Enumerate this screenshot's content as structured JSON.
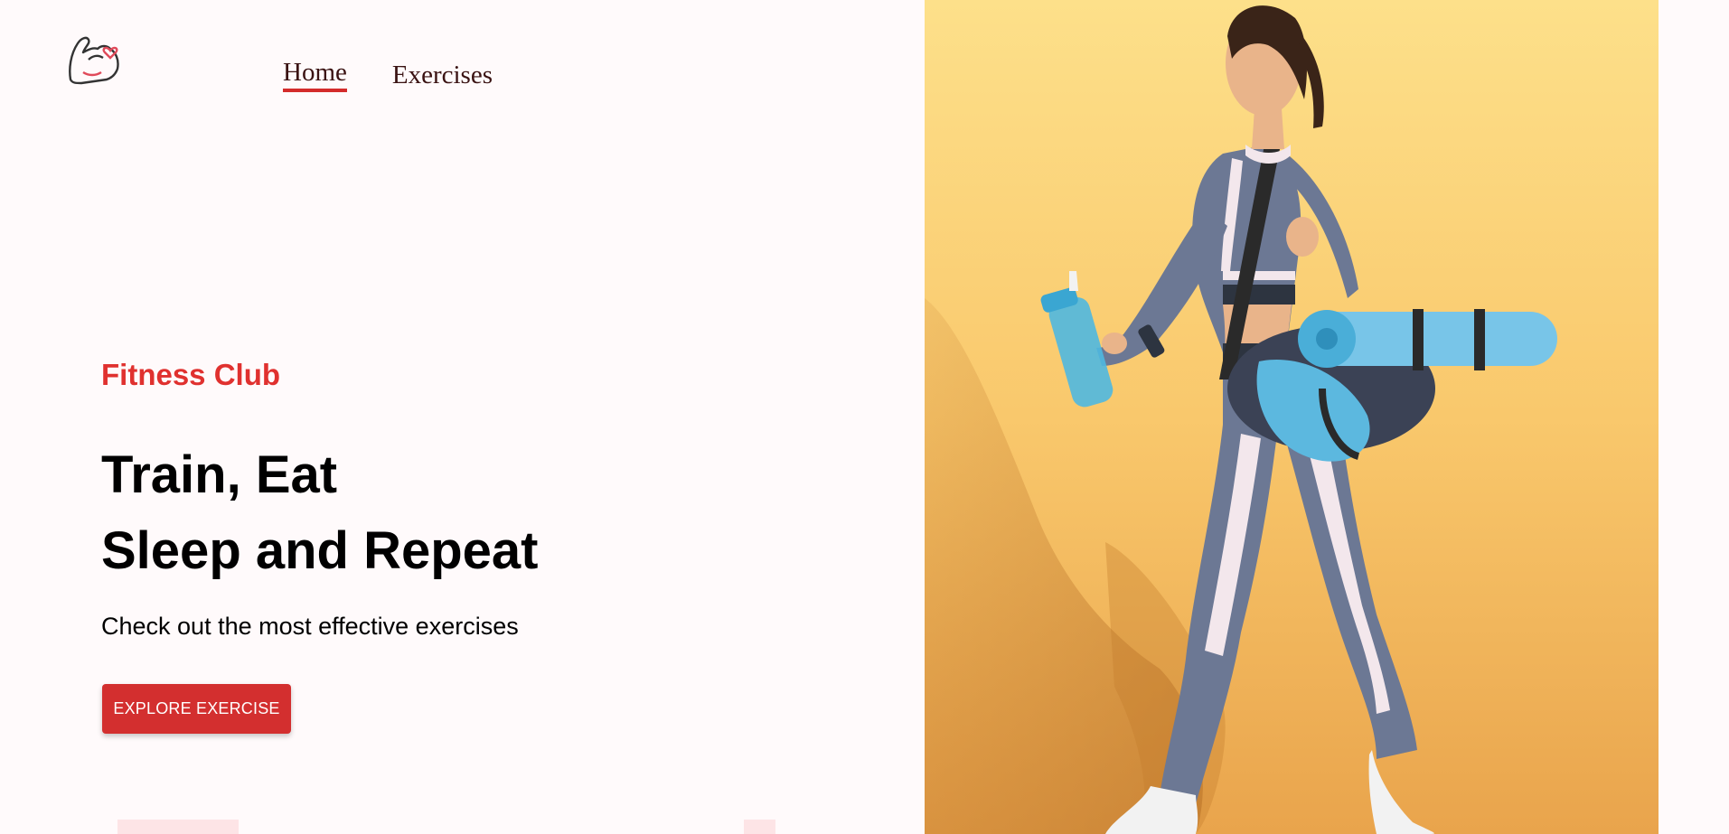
{
  "nav": {
    "home": "Home",
    "exercises": "Exercises"
  },
  "hero": {
    "tagline": "Fitness Club",
    "headline_line1": "Train, Eat",
    "headline_line2": "Sleep and Repeat",
    "subtext": "Check out the most effective exercises",
    "cta_label": "EXPLORE EXERCISE"
  },
  "colors": {
    "accent": "#d32f2f",
    "tagline": "#e0312f",
    "page_background": "#fffafb",
    "photo_background": "#f7c46a"
  },
  "icons": {
    "logo": "flexed-bicep-heart-icon"
  }
}
